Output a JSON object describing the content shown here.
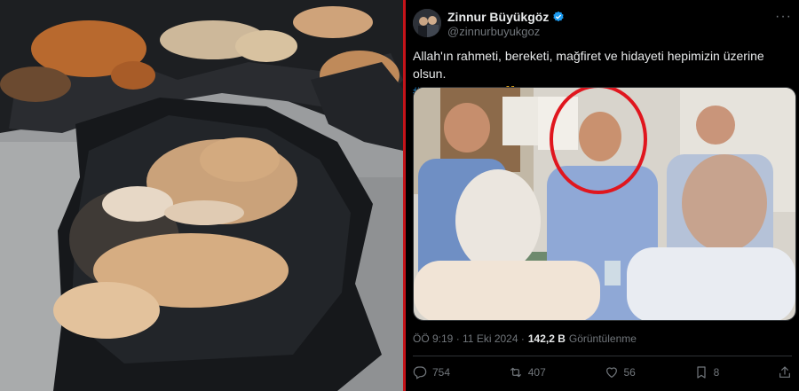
{
  "tweet": {
    "author_name": "Zinnur Büyükgöz",
    "handle": "@zinnurbuyukgoz",
    "text": "Allah'ın rahmeti, bereketi, mağfiret ve hidayeti hepimizin üzerine olsun.",
    "hashtag": "#HayırlıCumalar",
    "emoji": "🤲",
    "time": "ÖÖ 9:19 · 11 Eki 2024 ·",
    "views_count": "142,2 B",
    "views_label": "Görüntülenme",
    "replies": "754",
    "reposts": "407",
    "likes": "56",
    "bookmarks": "8"
  },
  "colors": {
    "accent": "#1d9bf0",
    "divider": "#c3141a",
    "highlight_circle": "#e0161e"
  },
  "icons": [
    "verified-badge-icon",
    "more-icon",
    "reply-icon",
    "repost-icon",
    "like-icon",
    "bookmark-icon",
    "share-icon"
  ]
}
